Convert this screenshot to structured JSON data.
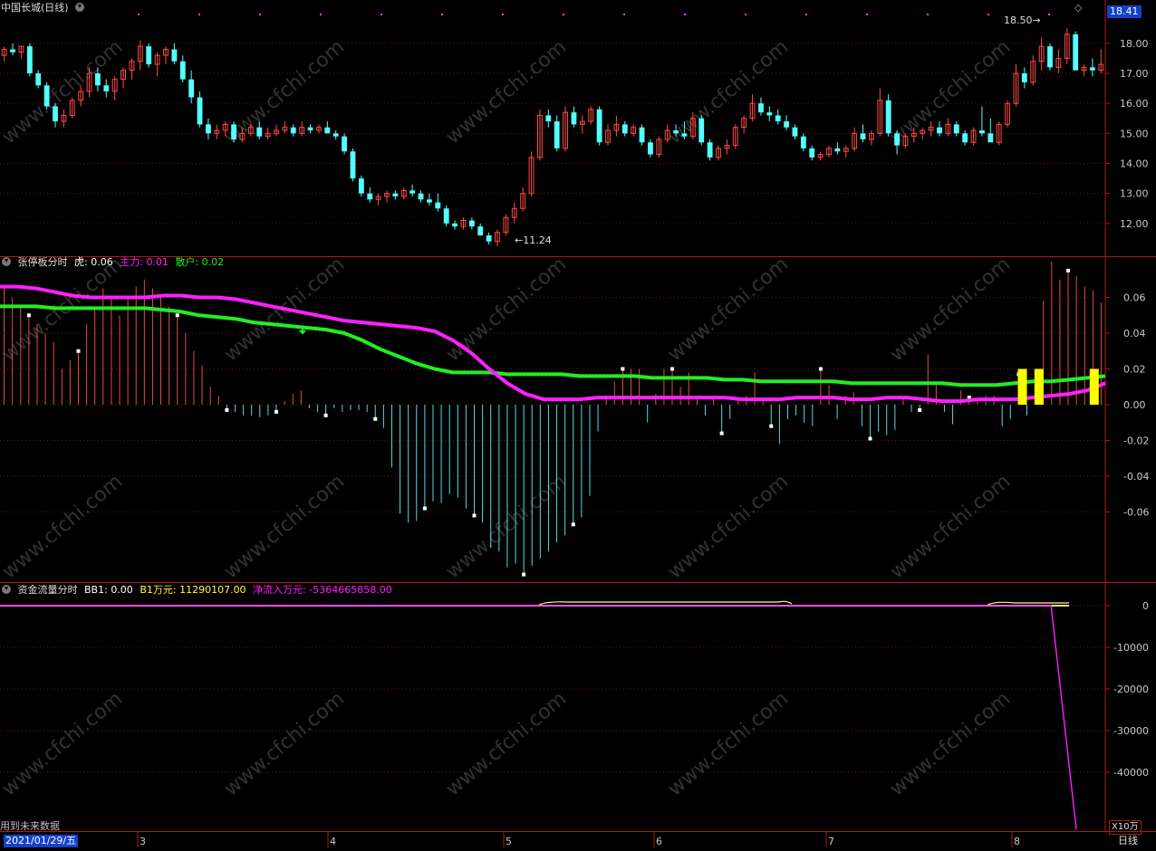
{
  "colors": {
    "background": "#000000",
    "panel_border": "#b01818",
    "grid": "#6a1010",
    "up": "#ff4a4a",
    "down": "#54ffff",
    "main_line": "#ff20ff",
    "retail_line": "#22ee22",
    "highlight_bar": "#ffff00",
    "axis_text": "#c8c8c8"
  },
  "price_panel": {
    "title": "中国长城(日线)",
    "current_price_badge": "18.41",
    "high_marker": "18.50",
    "low_marker": "11.24",
    "y_ticks": [
      "18.00",
      "17.00",
      "16.00",
      "15.00",
      "14.00",
      "13.00",
      "12.00"
    ]
  },
  "indicator_panel": {
    "name": "张停板分时",
    "fields": [
      {
        "label": "虎:",
        "value": "0.06",
        "color": "#ffffff"
      },
      {
        "label": "主力:",
        "value": "0.01",
        "color": "#ff20ff"
      },
      {
        "label": "散户:",
        "value": "0.02",
        "color": "#22ee22"
      }
    ],
    "y_ticks": [
      "0.06",
      "0.04",
      "0.02",
      "0.00",
      "-0.02",
      "-0.04",
      "-0.06"
    ]
  },
  "flow_panel": {
    "name": "资金流量分时",
    "fields": [
      {
        "label": "BB1:",
        "value": "0.00",
        "color": "#ffffff"
      },
      {
        "label": "B1万元:",
        "value": "11290107.00",
        "color": "#ffff40"
      },
      {
        "label": "净流入万元:",
        "value": "-5364665858.00",
        "color": "#ff20ff"
      }
    ],
    "y_ticks": [
      "0",
      "-10000",
      "-20000",
      "-30000",
      "-40000"
    ],
    "unit": "X10万"
  },
  "footer": {
    "future_data_note": "用到未来数据",
    "date_cursor": "2021/01/29/五",
    "period": "日线",
    "x_ticks": [
      "3",
      "4",
      "5",
      "6",
      "7",
      "8"
    ]
  },
  "chart_data": {
    "type": "candlestick",
    "price_range": [
      11.0,
      18.9
    ],
    "candles": [
      [
        17.6,
        17.9,
        17.4,
        17.8
      ],
      [
        17.8,
        18.0,
        17.6,
        17.7
      ],
      [
        17.7,
        17.9,
        17.5,
        17.9
      ],
      [
        17.9,
        18.0,
        16.9,
        17.0
      ],
      [
        17.0,
        17.1,
        16.5,
        16.6
      ],
      [
        16.6,
        16.7,
        15.8,
        15.9
      ],
      [
        15.9,
        16.0,
        15.2,
        15.4
      ],
      [
        15.4,
        15.8,
        15.2,
        15.6
      ],
      [
        15.6,
        16.2,
        15.5,
        16.1
      ],
      [
        16.1,
        16.6,
        15.9,
        16.4
      ],
      [
        16.4,
        17.2,
        16.2,
        17.0
      ],
      [
        17.0,
        17.2,
        16.4,
        16.6
      ],
      [
        16.6,
        16.8,
        16.2,
        16.4
      ],
      [
        16.4,
        16.9,
        16.1,
        16.8
      ],
      [
        16.8,
        17.2,
        16.5,
        17.1
      ],
      [
        17.1,
        17.5,
        16.8,
        17.4
      ],
      [
        17.4,
        18.1,
        17.1,
        17.9
      ],
      [
        17.9,
        18.0,
        17.2,
        17.3
      ],
      [
        17.3,
        17.7,
        16.9,
        17.6
      ],
      [
        17.6,
        17.9,
        17.3,
        17.8
      ],
      [
        17.8,
        18.0,
        17.3,
        17.4
      ],
      [
        17.4,
        17.6,
        16.7,
        16.8
      ],
      [
        16.8,
        17.1,
        16.0,
        16.2
      ],
      [
        16.2,
        16.4,
        15.2,
        15.3
      ],
      [
        15.3,
        15.5,
        14.8,
        15.0
      ],
      [
        15.0,
        15.3,
        14.8,
        15.1
      ],
      [
        15.1,
        15.4,
        14.9,
        15.3
      ],
      [
        15.3,
        15.4,
        14.7,
        14.8
      ],
      [
        14.8,
        15.2,
        14.7,
        15.0
      ],
      [
        15.0,
        15.3,
        14.9,
        15.2
      ],
      [
        15.2,
        15.4,
        14.8,
        14.9
      ],
      [
        14.9,
        15.2,
        14.8,
        15.0
      ],
      [
        15.0,
        15.3,
        14.9,
        15.1
      ],
      [
        15.1,
        15.4,
        15.0,
        15.2
      ],
      [
        15.2,
        15.3,
        14.9,
        15.0
      ],
      [
        15.0,
        15.4,
        14.9,
        15.2
      ],
      [
        15.2,
        15.3,
        15.0,
        15.1
      ],
      [
        15.1,
        15.3,
        15.0,
        15.2
      ],
      [
        15.2,
        15.4,
        15.0,
        15.0
      ],
      [
        15.0,
        15.1,
        14.8,
        14.9
      ],
      [
        14.9,
        15.0,
        14.3,
        14.4
      ],
      [
        14.4,
        14.5,
        13.4,
        13.5
      ],
      [
        13.5,
        13.6,
        12.9,
        13.0
      ],
      [
        13.0,
        13.2,
        12.7,
        12.8
      ],
      [
        12.8,
        13.0,
        12.6,
        12.9
      ],
      [
        12.9,
        13.1,
        12.7,
        13.0
      ],
      [
        13.0,
        13.1,
        12.8,
        12.9
      ],
      [
        12.9,
        13.2,
        12.8,
        13.1
      ],
      [
        13.1,
        13.3,
        12.9,
        13.0
      ],
      [
        13.0,
        13.1,
        12.7,
        12.8
      ],
      [
        12.8,
        13.0,
        12.6,
        12.7
      ],
      [
        12.7,
        13.0,
        12.4,
        12.5
      ],
      [
        12.5,
        12.6,
        11.9,
        12.0
      ],
      [
        12.0,
        12.1,
        11.8,
        11.9
      ],
      [
        11.9,
        12.2,
        11.8,
        12.1
      ],
      [
        12.1,
        12.2,
        11.8,
        11.9
      ],
      [
        11.9,
        12.0,
        11.6,
        11.6
      ],
      [
        11.6,
        11.7,
        11.3,
        11.4
      ],
      [
        11.4,
        11.8,
        11.24,
        11.7
      ],
      [
        11.7,
        12.3,
        11.6,
        12.2
      ],
      [
        12.2,
        12.7,
        12.0,
        12.5
      ],
      [
        12.5,
        13.2,
        12.4,
        13.0
      ],
      [
        13.0,
        14.4,
        12.9,
        14.2
      ],
      [
        14.2,
        15.8,
        14.1,
        15.6
      ],
      [
        15.6,
        15.8,
        15.2,
        15.4
      ],
      [
        15.4,
        15.6,
        14.4,
        14.5
      ],
      [
        14.5,
        15.9,
        14.4,
        15.7
      ],
      [
        15.7,
        15.9,
        15.2,
        15.3
      ],
      [
        15.3,
        15.6,
        15.0,
        15.4
      ],
      [
        15.4,
        15.9,
        15.3,
        15.8
      ],
      [
        15.8,
        15.9,
        14.6,
        14.7
      ],
      [
        14.7,
        15.3,
        14.6,
        15.1
      ],
      [
        15.1,
        15.6,
        14.9,
        15.3
      ],
      [
        15.3,
        15.4,
        14.9,
        15.0
      ],
      [
        15.0,
        15.3,
        14.9,
        15.2
      ],
      [
        15.2,
        15.3,
        14.6,
        14.7
      ],
      [
        14.7,
        14.8,
        14.2,
        14.3
      ],
      [
        14.3,
        14.9,
        14.2,
        14.8
      ],
      [
        14.8,
        15.3,
        14.7,
        15.1
      ],
      [
        15.1,
        15.3,
        14.9,
        15.0
      ],
      [
        15.0,
        15.4,
        14.8,
        14.9
      ],
      [
        14.9,
        15.7,
        14.8,
        15.5
      ],
      [
        15.5,
        15.6,
        14.6,
        14.7
      ],
      [
        14.7,
        14.8,
        14.1,
        14.2
      ],
      [
        14.2,
        14.6,
        14.1,
        14.5
      ],
      [
        14.5,
        14.8,
        14.3,
        14.6
      ],
      [
        14.6,
        15.3,
        14.5,
        15.2
      ],
      [
        15.2,
        15.6,
        15.0,
        15.5
      ],
      [
        15.5,
        16.3,
        15.4,
        16.0
      ],
      [
        16.0,
        16.2,
        15.6,
        15.7
      ],
      [
        15.7,
        15.9,
        15.4,
        15.6
      ],
      [
        15.6,
        15.8,
        15.3,
        15.4
      ],
      [
        15.4,
        15.6,
        15.1,
        15.2
      ],
      [
        15.2,
        15.3,
        14.8,
        14.9
      ],
      [
        14.9,
        15.0,
        14.4,
        14.5
      ],
      [
        14.5,
        14.6,
        14.1,
        14.2
      ],
      [
        14.2,
        14.4,
        14.1,
        14.3
      ],
      [
        14.3,
        14.6,
        14.2,
        14.5
      ],
      [
        14.5,
        14.7,
        14.3,
        14.4
      ],
      [
        14.4,
        14.6,
        14.2,
        14.5
      ],
      [
        14.5,
        15.2,
        14.4,
        15.0
      ],
      [
        15.0,
        15.3,
        14.7,
        14.8
      ],
      [
        14.8,
        15.1,
        14.6,
        15.0
      ],
      [
        15.0,
        16.5,
        14.9,
        16.1
      ],
      [
        16.1,
        16.3,
        14.9,
        15.0
      ],
      [
        15.0,
        15.1,
        14.3,
        14.6
      ],
      [
        14.6,
        15.0,
        14.5,
        14.9
      ],
      [
        14.9,
        15.2,
        14.7,
        15.0
      ],
      [
        15.0,
        15.2,
        14.8,
        15.1
      ],
      [
        15.1,
        15.4,
        14.9,
        15.2
      ],
      [
        15.2,
        15.4,
        14.9,
        15.0
      ],
      [
        15.0,
        15.5,
        14.9,
        15.3
      ],
      [
        15.3,
        15.4,
        14.9,
        15.0
      ],
      [
        15.0,
        15.1,
        14.6,
        14.7
      ],
      [
        14.7,
        15.2,
        14.6,
        15.1
      ],
      [
        15.1,
        15.9,
        14.9,
        15.0
      ],
      [
        15.0,
        15.5,
        14.8,
        14.7
      ],
      [
        14.7,
        15.4,
        14.6,
        15.3
      ],
      [
        15.3,
        16.1,
        15.2,
        16.0
      ],
      [
        16.0,
        17.3,
        15.9,
        17.0
      ],
      [
        17.0,
        17.2,
        16.5,
        16.7
      ],
      [
        16.7,
        17.6,
        16.6,
        17.4
      ],
      [
        17.4,
        18.2,
        17.1,
        17.9
      ],
      [
        17.9,
        18.0,
        17.1,
        17.2
      ],
      [
        17.2,
        17.8,
        17.0,
        17.5
      ],
      [
        17.5,
        18.5,
        17.3,
        18.3
      ],
      [
        18.3,
        18.4,
        17.2,
        17.1
      ],
      [
        17.1,
        17.3,
        16.9,
        17.2
      ],
      [
        17.2,
        17.5,
        16.9,
        17.1
      ],
      [
        17.1,
        17.8,
        17.0,
        17.3
      ]
    ],
    "tiger_bars": [
      0.065,
      0.06,
      0.055,
      0.05,
      0.045,
      0.04,
      0.035,
      0.02,
      0.025,
      0.03,
      0.045,
      0.055,
      0.065,
      0.06,
      0.05,
      0.06,
      0.066,
      0.07,
      0.065,
      0.06,
      0.055,
      0.05,
      0.04,
      0.03,
      0.022,
      0.01,
      0.005,
      -0.003,
      -0.004,
      -0.006,
      -0.006,
      -0.007,
      -0.006,
      -0.004,
      0.002,
      0.006,
      0.008,
      -0.002,
      -0.004,
      -0.006,
      -0.002,
      -0.004,
      -0.003,
      -0.003,
      -0.004,
      -0.008,
      -0.013,
      -0.035,
      -0.061,
      -0.066,
      -0.065,
      -0.058,
      -0.054,
      -0.055,
      -0.05,
      -0.052,
      -0.058,
      -0.062,
      -0.066,
      -0.08,
      -0.082,
      -0.091,
      -0.089,
      -0.095,
      -0.09,
      -0.086,
      -0.082,
      -0.077,
      -0.073,
      -0.067,
      -0.063,
      -0.051,
      -0.015,
      0.005,
      0.013,
      0.02,
      0.02,
      0.02,
      -0.01,
      0.006,
      0.02,
      0.02,
      0.01,
      0.018,
      0.005,
      -0.006,
      0.003,
      -0.016,
      -0.008,
      0.004,
      0.005,
      0.018,
      0.002,
      -0.012,
      -0.022,
      -0.008,
      -0.006,
      -0.01,
      -0.012,
      0.02,
      0.011,
      -0.008,
      0.005,
      0.007,
      -0.012,
      -0.019,
      -0.015,
      -0.017,
      -0.014,
      0.004,
      -0.004,
      -0.003,
      0.028,
      0.011,
      -0.004,
      -0.011,
      0.008,
      0.004,
      0.003,
      0.005,
      0.005,
      -0.012,
      -0.008,
      0.017,
      -0.006,
      0.005,
      0.058,
      0.08,
      0.07,
      0.075,
      0.072,
      0.066,
      0.064,
      0.057
    ],
    "main_force": [
      0.066,
      0.066,
      0.065,
      0.063,
      0.061,
      0.06,
      0.06,
      0.06,
      0.06,
      0.061,
      0.061,
      0.06,
      0.06,
      0.059,
      0.057,
      0.055,
      0.053,
      0.051,
      0.049,
      0.047,
      0.046,
      0.045,
      0.044,
      0.043,
      0.041,
      0.036,
      0.029,
      0.02,
      0.012,
      0.006,
      0.003,
      0.003,
      0.003,
      0.004,
      0.004,
      0.004,
      0.004,
      0.004,
      0.004,
      0.004,
      0.004,
      0.003,
      0.003,
      0.003,
      0.004,
      0.004,
      0.004,
      0.003,
      0.003,
      0.004,
      0.004,
      0.003,
      0.002,
      0.002,
      0.003,
      0.003,
      0.003,
      0.004,
      0.005,
      0.006,
      0.008,
      0.012
    ],
    "retail": [
      0.055,
      0.055,
      0.055,
      0.054,
      0.054,
      0.054,
      0.054,
      0.054,
      0.054,
      0.053,
      0.052,
      0.05,
      0.049,
      0.048,
      0.046,
      0.045,
      0.044,
      0.043,
      0.042,
      0.04,
      0.036,
      0.031,
      0.027,
      0.023,
      0.02,
      0.018,
      0.018,
      0.018,
      0.017,
      0.017,
      0.017,
      0.017,
      0.016,
      0.016,
      0.016,
      0.016,
      0.015,
      0.015,
      0.015,
      0.015,
      0.014,
      0.014,
      0.013,
      0.013,
      0.013,
      0.013,
      0.013,
      0.012,
      0.012,
      0.012,
      0.012,
      0.012,
      0.012,
      0.011,
      0.011,
      0.011,
      0.012,
      0.013,
      0.013,
      0.014,
      0.015,
      0.016
    ],
    "highlight_positions": [
      0.925,
      0.94,
      0.99
    ],
    "flow_series_x10k": [
      0,
      0,
      0,
      0,
      0,
      0,
      0,
      0,
      0,
      0,
      0,
      0,
      0,
      0,
      0,
      0,
      0,
      0,
      0,
      0,
      0,
      0,
      0,
      0,
      0,
      0,
      0,
      0,
      0,
      0,
      0,
      0,
      0,
      0,
      0,
      0,
      0,
      0,
      0,
      0,
      0,
      0,
      0,
      0,
      0,
      0,
      0,
      0,
      0,
      0,
      0,
      0,
      0,
      0,
      0,
      0,
      0,
      0,
      0,
      0,
      -53646
    ]
  }
}
